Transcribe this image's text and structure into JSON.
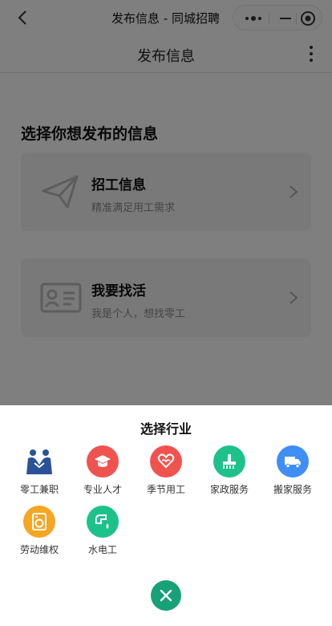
{
  "window": {
    "title": "发布信息 - 同城招聘"
  },
  "nav": {
    "title": "发布信息"
  },
  "main": {
    "section_title": "选择你想发布的信息",
    "cards": [
      {
        "title": "招工信息",
        "subtitle": "精准满足用工需求",
        "icon": "paper-plane-icon"
      },
      {
        "title": "我要找活",
        "subtitle": "我是个人，想找零工",
        "icon": "id-card-icon"
      }
    ]
  },
  "sheet": {
    "title": "选择行业",
    "categories": [
      {
        "label": "零工兼职",
        "icon": "handshake-icon",
        "color": "#2a5298"
      },
      {
        "label": "专业人才",
        "icon": "graduation-cap-icon",
        "color": "#f0534f"
      },
      {
        "label": "季节用工",
        "icon": "heart-hand-icon",
        "color": "#f0534f"
      },
      {
        "label": "家政服务",
        "icon": "broom-icon",
        "color": "#1cc28a"
      },
      {
        "label": "搬家服务",
        "icon": "truck-icon",
        "color": "#3f8ef5"
      },
      {
        "label": "劳动维权",
        "icon": "washer-icon",
        "color": "#f5a623"
      },
      {
        "label": "水电工",
        "icon": "faucet-icon",
        "color": "#1cc28a"
      }
    ]
  },
  "colors": {
    "accent": "#17a176",
    "overlay": "rgba(0,0,0,0.5)"
  }
}
